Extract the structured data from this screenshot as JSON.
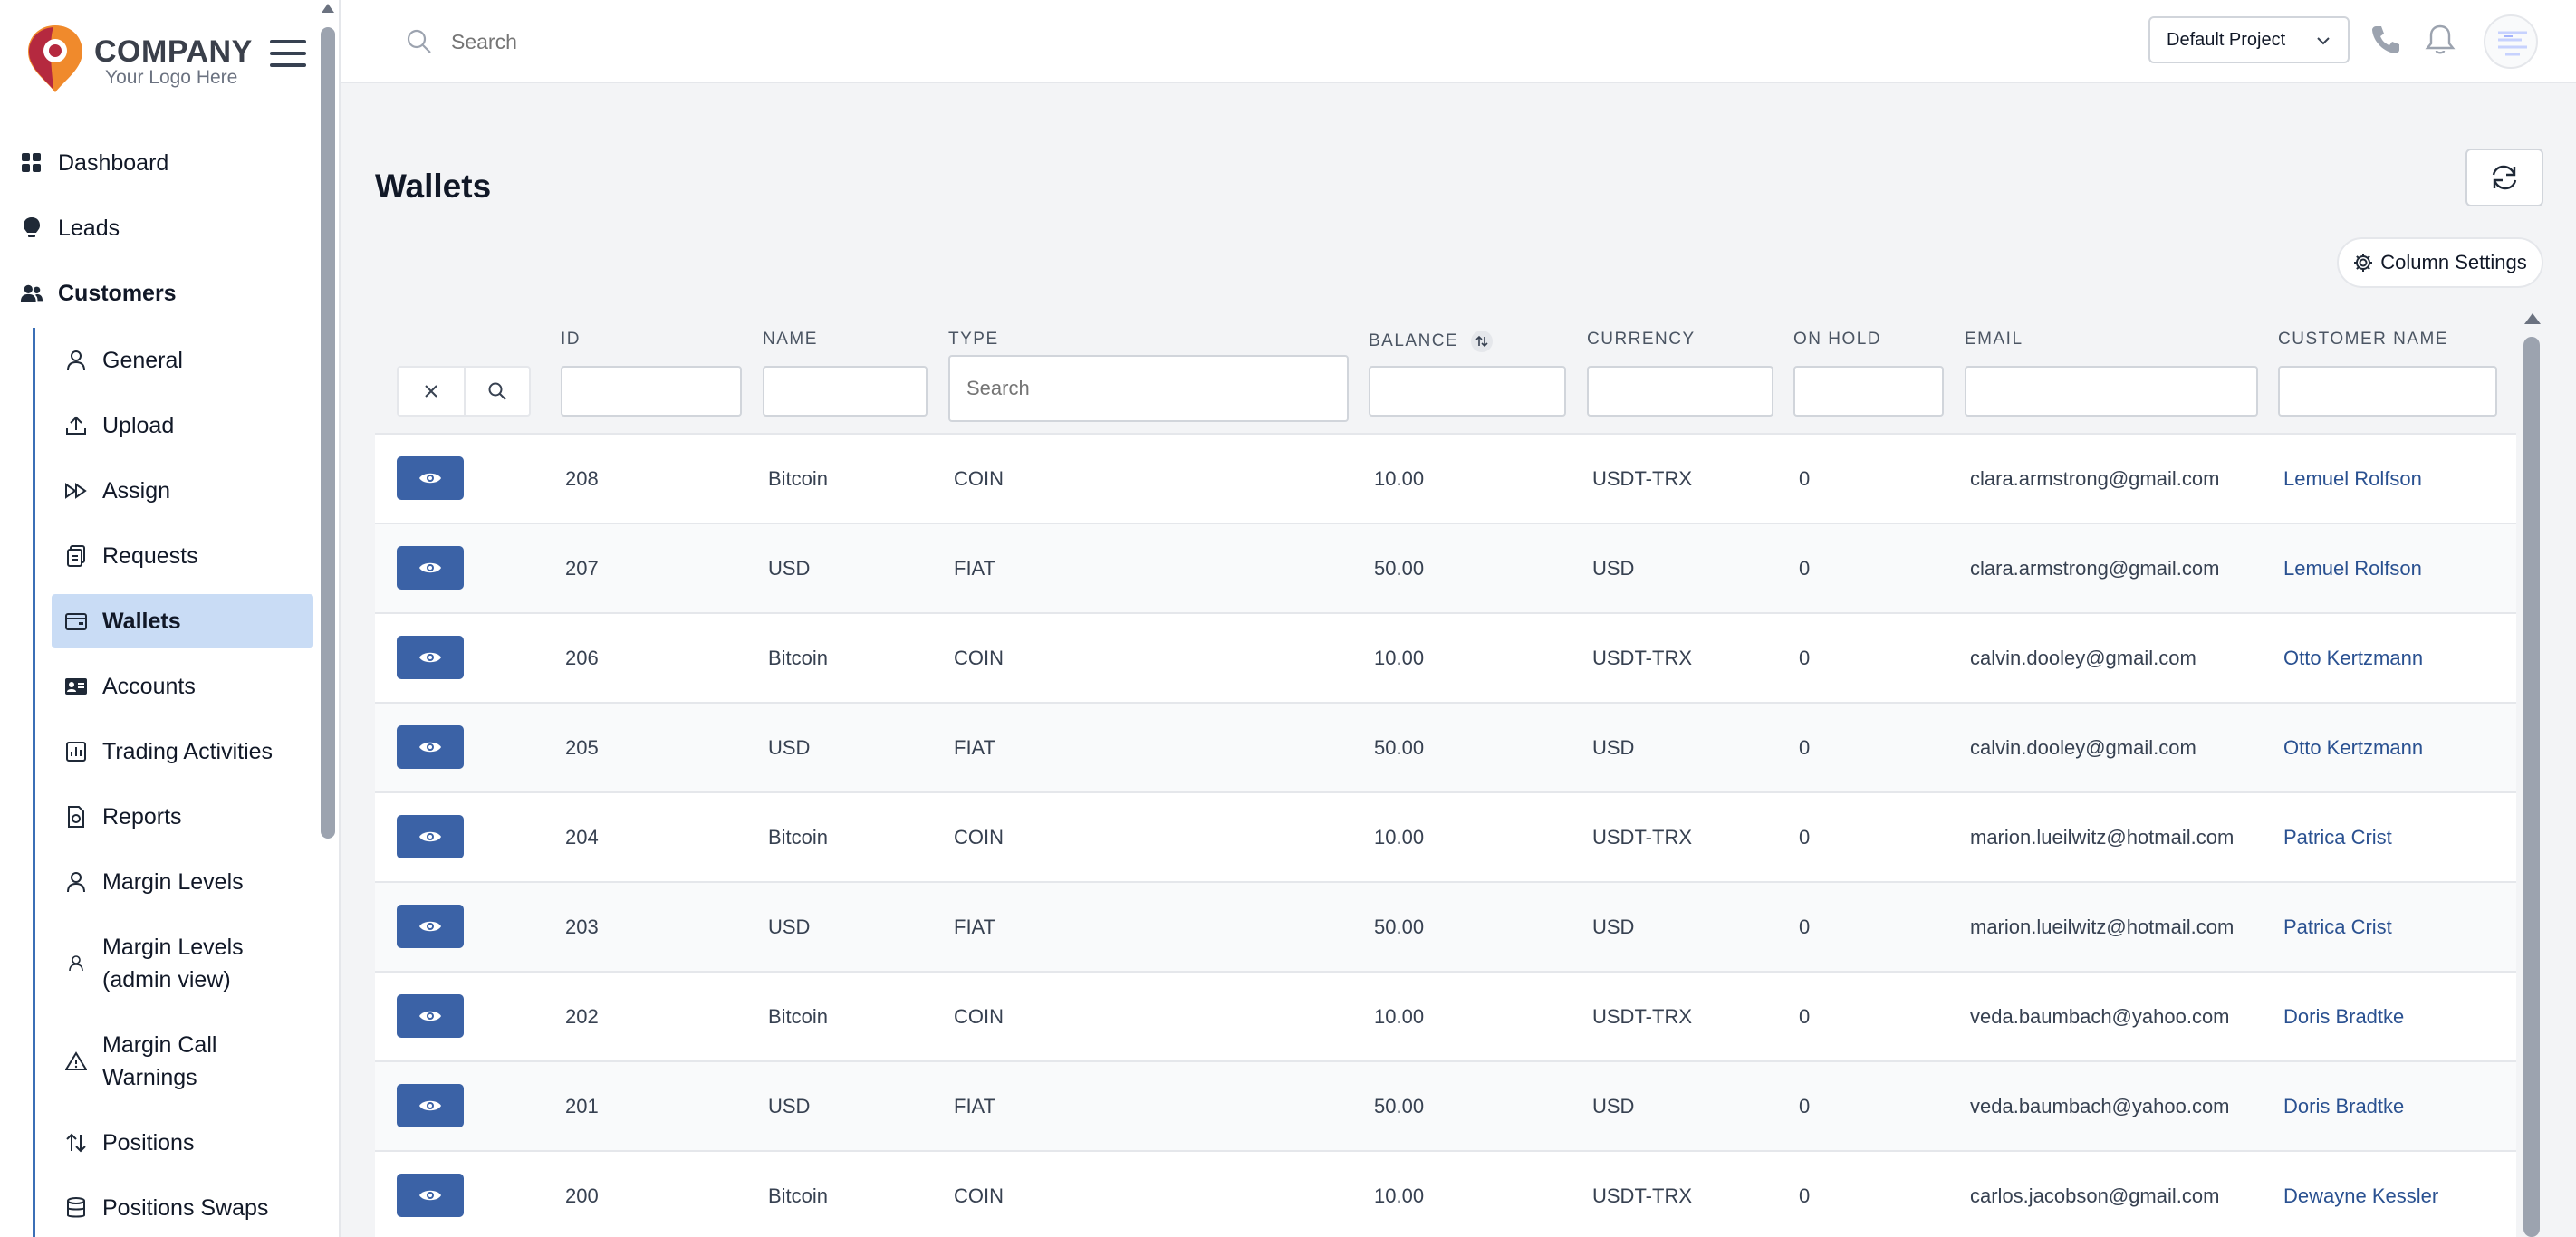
{
  "brand": {
    "name": "COMPANY",
    "tagline": "Your Logo Here",
    "colors": {
      "pin_red": "#b5293f",
      "pin_orange": "#f08a2c"
    }
  },
  "search": {
    "placeholder": "Search"
  },
  "header": {
    "project_select": "Default Project",
    "icons": [
      "phone-icon",
      "bell-icon",
      "avatar"
    ]
  },
  "sidebar": {
    "main_items": [
      {
        "label": "Dashboard",
        "icon": "grid-icon"
      },
      {
        "label": "Leads",
        "icon": "lightbulb-icon"
      },
      {
        "label": "Customers",
        "icon": "users-icon"
      }
    ],
    "sub_items": [
      {
        "label": "General",
        "icon": "user-icon"
      },
      {
        "label": "Upload",
        "icon": "upload-icon"
      },
      {
        "label": "Assign",
        "icon": "fast-forward-icon"
      },
      {
        "label": "Requests",
        "icon": "clipboard-icon"
      },
      {
        "label": "Wallets",
        "icon": "wallet-icon",
        "active": true
      },
      {
        "label": "Accounts",
        "icon": "id-card-icon"
      },
      {
        "label": "Trading Activities",
        "icon": "bar-chart-icon"
      },
      {
        "label": "Reports",
        "icon": "report-icon"
      },
      {
        "label": "Margin Levels",
        "icon": "user-icon"
      },
      {
        "label": "Margin Levels (admin view)",
        "icon": "user-small-icon"
      },
      {
        "label": "Margin Call Warnings",
        "icon": "warning-icon"
      },
      {
        "label": "Positions",
        "icon": "swap-vertical-icon"
      },
      {
        "label": "Positions Swaps",
        "icon": "database-icon"
      }
    ]
  },
  "main": {
    "title": "Wallets",
    "column_settings_label": "Column Settings",
    "accent_color": "#3b62a6",
    "active_nav_bg": "#c9dcf5"
  },
  "table": {
    "columns": [
      "ID",
      "NAME",
      "TYPE",
      "BALANCE",
      "CURRENCY",
      "ON HOLD",
      "EMAIL",
      "CUSTOMER NAME"
    ],
    "type_filter_placeholder": "Search",
    "rows": [
      {
        "id": "208",
        "name": "Bitcoin",
        "type": "COIN",
        "balance": "10.00",
        "currency": "USDT-TRX",
        "on_hold": "0",
        "email": "clara.armstrong@gmail.com",
        "customer": "Lemuel Rolfson"
      },
      {
        "id": "207",
        "name": "USD",
        "type": "FIAT",
        "balance": "50.00",
        "currency": "USD",
        "on_hold": "0",
        "email": "clara.armstrong@gmail.com",
        "customer": "Lemuel Rolfson"
      },
      {
        "id": "206",
        "name": "Bitcoin",
        "type": "COIN",
        "balance": "10.00",
        "currency": "USDT-TRX",
        "on_hold": "0",
        "email": "calvin.dooley@gmail.com",
        "customer": "Otto Kertzmann"
      },
      {
        "id": "205",
        "name": "USD",
        "type": "FIAT",
        "balance": "50.00",
        "currency": "USD",
        "on_hold": "0",
        "email": "calvin.dooley@gmail.com",
        "customer": "Otto Kertzmann"
      },
      {
        "id": "204",
        "name": "Bitcoin",
        "type": "COIN",
        "balance": "10.00",
        "currency": "USDT-TRX",
        "on_hold": "0",
        "email": "marion.lueilwitz@hotmail.com",
        "customer": "Patrica Crist"
      },
      {
        "id": "203",
        "name": "USD",
        "type": "FIAT",
        "balance": "50.00",
        "currency": "USD",
        "on_hold": "0",
        "email": "marion.lueilwitz@hotmail.com",
        "customer": "Patrica Crist"
      },
      {
        "id": "202",
        "name": "Bitcoin",
        "type": "COIN",
        "balance": "10.00",
        "currency": "USDT-TRX",
        "on_hold": "0",
        "email": "veda.baumbach@yahoo.com",
        "customer": "Doris Bradtke"
      },
      {
        "id": "201",
        "name": "USD",
        "type": "FIAT",
        "balance": "50.00",
        "currency": "USD",
        "on_hold": "0",
        "email": "veda.baumbach@yahoo.com",
        "customer": "Doris Bradtke"
      },
      {
        "id": "200",
        "name": "Bitcoin",
        "type": "COIN",
        "balance": "10.00",
        "currency": "USDT-TRX",
        "on_hold": "0",
        "email": "carlos.jacobson@gmail.com",
        "customer": "Dewayne Kessler"
      }
    ]
  }
}
